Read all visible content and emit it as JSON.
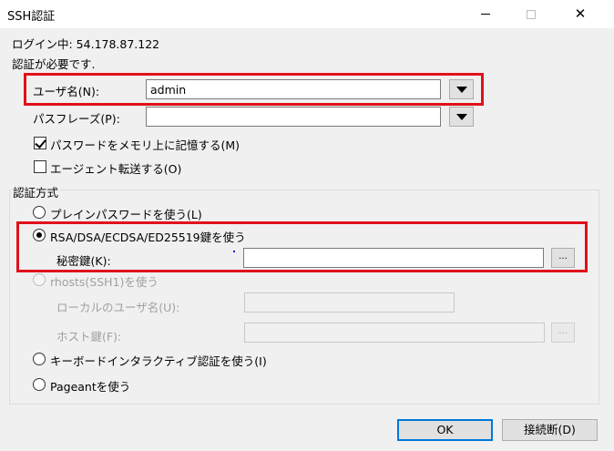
{
  "window": {
    "title": "SSH認証",
    "close_glyph": "✕"
  },
  "info": {
    "login_line": "ログイン中: 54.178.87.122",
    "auth_required": "認証が必要です."
  },
  "username": {
    "label": "ユーザ名(N):",
    "value": "admin"
  },
  "passphrase": {
    "label": "パスフレーズ(P):",
    "value": ""
  },
  "options": {
    "remember_password": {
      "label": "パスワードをメモリ上に記憶する(M)",
      "checked": true
    },
    "agent_forward": {
      "label": "エージェント転送する(O)",
      "checked": false
    }
  },
  "auth_method": {
    "group_label": "認証方式",
    "plain_password": {
      "label": "プレインパスワードを使う(L)",
      "selected": false
    },
    "rsa_key": {
      "label": "RSA/DSA/ECDSA/ED25519鍵を使う",
      "selected": true
    },
    "private_key_label": "秘密鍵(K):",
    "private_key_value": "",
    "browse_label": "...",
    "rhosts": {
      "label": "rhosts(SSH1)を使う",
      "local_user_label": "ローカルのユーザ名(U):",
      "host_key_label": "ホスト鍵(F):",
      "browse_label": "..."
    },
    "keyboard_interactive": {
      "label": "キーボードインタラクティブ認証を使う(I)",
      "selected": false
    },
    "pageant": {
      "label": "Pageantを使う",
      "selected": false
    }
  },
  "buttons": {
    "ok": "OK",
    "disconnect": "接続断(D)"
  },
  "colors": {
    "highlight": "#e0111a",
    "focus": "#0078d7",
    "background": "#f0f0f0"
  }
}
